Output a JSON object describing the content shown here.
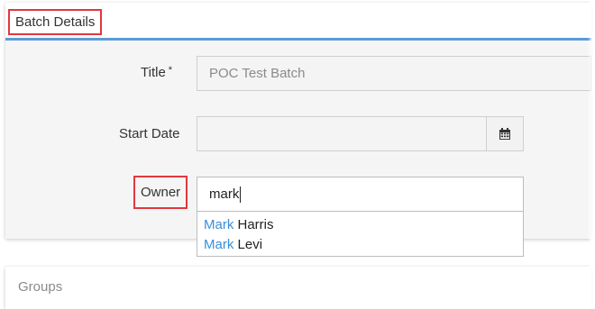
{
  "panel": {
    "title": "Batch Details"
  },
  "form": {
    "title_label": "Title",
    "title_required_mark": "*",
    "title_value": "POC Test Batch",
    "start_date_label": "Start Date",
    "start_date_value": "",
    "owner_label": "Owner",
    "owner_value": "mark"
  },
  "owner_suggestions": [
    {
      "match": "Mark",
      "rest": " Harris"
    },
    {
      "match": "Mark",
      "rest": " Levi"
    }
  ],
  "groups": {
    "title": "Groups"
  },
  "colors": {
    "accent": "#5b9bd5",
    "highlight_box": "#e0383e",
    "match_text": "#3c8dd9"
  },
  "icons": {
    "calendar": "calendar-icon"
  }
}
